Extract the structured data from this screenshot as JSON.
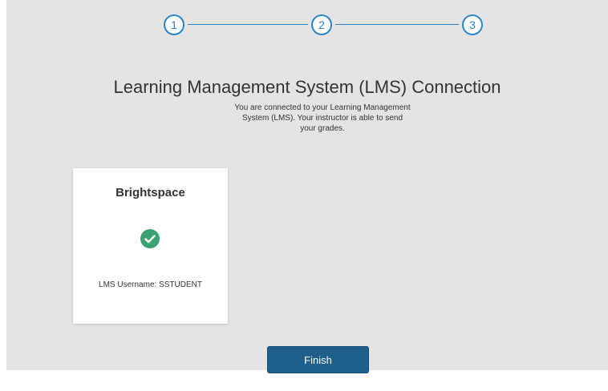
{
  "stepper": {
    "steps": [
      {
        "label": "1"
      },
      {
        "label": "2"
      },
      {
        "label": "3"
      }
    ]
  },
  "header": {
    "title": "Learning Management System (LMS) Connection",
    "description": "You are connected to your Learning Management System (LMS). Your instructor is able to send your grades."
  },
  "lms_card": {
    "name": "Brightspace",
    "status_icon": "check-circle-icon",
    "username_text": "LMS Username: SSTUDENT"
  },
  "actions": {
    "finish_label": "Finish"
  },
  "colors": {
    "accent": "#2b86c9",
    "success": "#3aa171",
    "button": "#1f5f8b",
    "background": "#e4e4e4"
  }
}
